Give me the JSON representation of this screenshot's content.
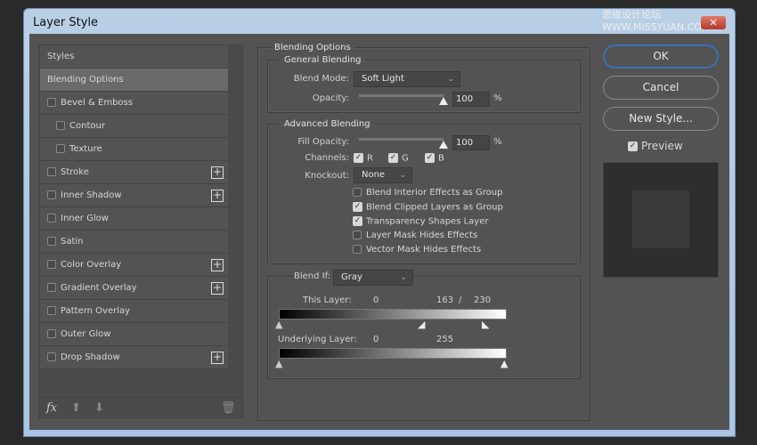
{
  "window": {
    "title": "Layer Style",
    "close": "✕",
    "watermark": "思缘设计论坛 WWW.MISSYUAN.COM"
  },
  "sidebar": {
    "items": [
      {
        "label": "Styles"
      },
      {
        "label": "Blending Options"
      },
      {
        "label": "Bevel & Emboss"
      },
      {
        "label": "Contour"
      },
      {
        "label": "Texture"
      },
      {
        "label": "Stroke"
      },
      {
        "label": "Inner Shadow"
      },
      {
        "label": "Inner Glow"
      },
      {
        "label": "Satin"
      },
      {
        "label": "Color Overlay"
      },
      {
        "label": "Gradient Overlay"
      },
      {
        "label": "Pattern Overlay"
      },
      {
        "label": "Outer Glow"
      },
      {
        "label": "Drop Shadow"
      }
    ],
    "plus": "+",
    "fx": "fx",
    "up": "⬆",
    "down": "⬇",
    "trash": "🗑"
  },
  "blending": {
    "title": "Blending Options",
    "general": {
      "title": "General Blending",
      "blend_mode_label": "Blend Mode:",
      "blend_mode": "Soft Light",
      "opacity_label": "Opacity:",
      "opacity": "100",
      "pct": "%",
      "opacity_value": 100
    },
    "advanced": {
      "title": "Advanced Blending",
      "fill_label": "Fill Opacity:",
      "fill": "100",
      "pct": "%",
      "channels_label": "Channels:",
      "r": "R",
      "g": "G",
      "b": "B",
      "knockout_label": "Knockout:",
      "knockout": "None",
      "options": [
        {
          "label": "Blend Interior Effects as Group",
          "checked": false
        },
        {
          "label": "Blend Clipped Layers as Group",
          "checked": true
        },
        {
          "label": "Transparency Shapes Layer",
          "checked": true
        },
        {
          "label": "Layer Mask Hides Effects",
          "checked": false
        },
        {
          "label": "Vector Mask Hides Effects",
          "checked": false
        }
      ]
    },
    "blendif": {
      "label": "Blend If:",
      "value": "Gray",
      "this_label": "This Layer:",
      "this_low": "0",
      "this_mid": "163",
      "slash": "/",
      "this_high": "230",
      "under_label": "Underlying Layer:",
      "under_low": "0",
      "under_high": "255"
    }
  },
  "buttons": {
    "ok": "OK",
    "cancel": "Cancel",
    "new_style": "New Style...",
    "preview": "Preview"
  }
}
